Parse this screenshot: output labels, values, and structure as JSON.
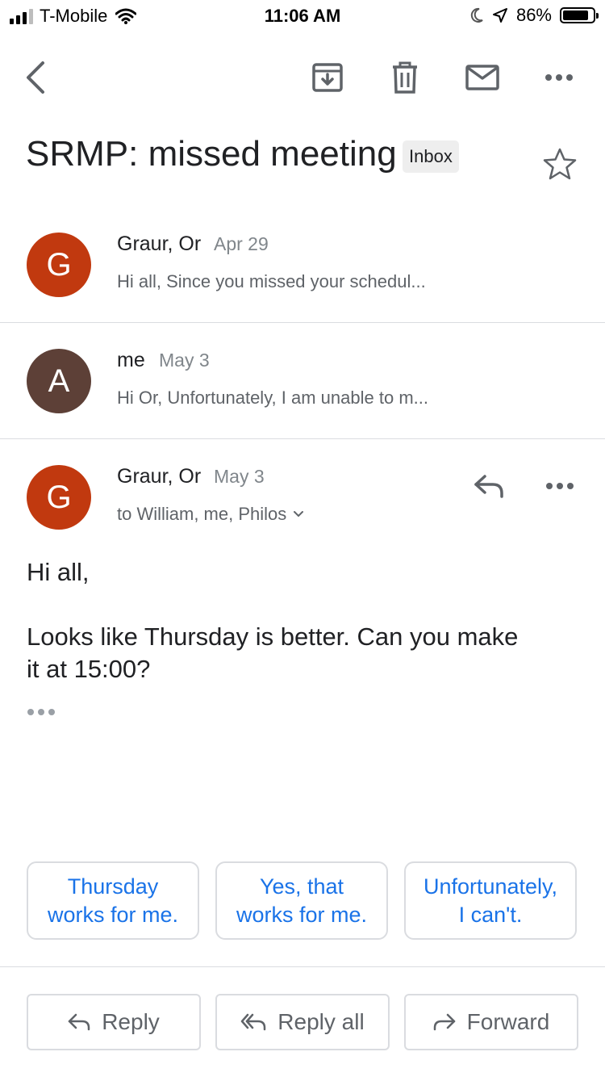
{
  "status_bar": {
    "carrier": "T-Mobile",
    "time": "11:06 AM",
    "battery": "86%",
    "battery_level": 0.86
  },
  "toolbar": {
    "icons": [
      "back-arrow-icon",
      "archive-icon",
      "delete-icon",
      "mark-unread-icon",
      "more-icon"
    ]
  },
  "email": {
    "subject": "SRMP: missed meeting",
    "label": "Inbox"
  },
  "messages": [
    {
      "avatar_letter": "G",
      "avatar_color": "#c1390f",
      "sender": "Graur, Or",
      "date": "Apr 29",
      "snippet": "Hi all, Since you missed your schedul..."
    },
    {
      "avatar_letter": "A",
      "avatar_color": "#5d4037",
      "sender": "me",
      "date": "May 3",
      "snippet": "Hi Or, Unfortunately, I am unable to m..."
    },
    {
      "avatar_letter": "G",
      "avatar_color": "#c1390f",
      "sender": "Graur, Or",
      "date": "May 3",
      "recipients": "to William, me, Philos",
      "body_greeting": "Hi all,",
      "body_line1": "Looks like Thursday is better. Can you make",
      "body_line2": "it at 15:00?"
    }
  ],
  "smart_replies": [
    {
      "line1": "Thursday",
      "line2": "works for me."
    },
    {
      "line1": "Yes, that",
      "line2": "works for me."
    },
    {
      "line1": "Unfortunately,",
      "line2": "I can't."
    }
  ],
  "actions": {
    "reply": "Reply",
    "reply_all": "Reply all",
    "forward": "Forward"
  },
  "colors": {
    "accent": "#1a73e8",
    "icon_gray": "#5f6368"
  }
}
